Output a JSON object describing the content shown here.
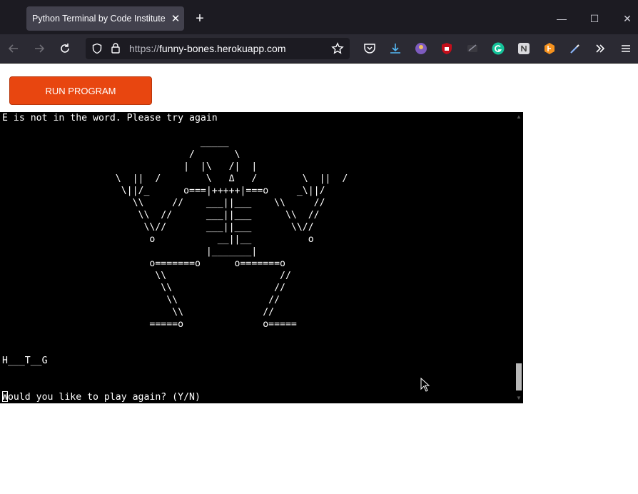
{
  "browser": {
    "tab_title": "Python Terminal by Code Institute",
    "tab_close": "✕",
    "new_tab": "+",
    "minimize": "—",
    "maximize": "☐",
    "close": "✕",
    "url_protocol": "https://",
    "url_domain": "funny-bones.herokuapp.com",
    "accent": "#1c1b22"
  },
  "page": {
    "run_button_label": "RUN PROGRAM",
    "run_button_color": "#e84610"
  },
  "terminal": {
    "lines": [
      "E is not in the word. Please try again",
      "",
      "                                   _____",
      "                                 /       \\",
      "                                |  |\\   /|  |",
      "                    \\  ||  /        \\   Δ   /        \\  ||  /",
      "                     \\||/_      o===|+++++|===o     _\\||/",
      "                       \\\\     //    ___||___    \\\\     //",
      "                        \\\\  //      ___||___      \\\\  //",
      "                         \\\\//       ___||___       \\\\//",
      "                          o           __||__          o",
      "                                    |_______|",
      "                          o=======o      o=======o",
      "                           \\\\                    //",
      "                            \\\\                  //",
      "                             \\\\                //",
      "                              \\\\              //",
      "                          =====o              o=====",
      "",
      "",
      "H___T__G",
      "",
      "",
      "Would you like to play again? (Y/N)"
    ]
  }
}
